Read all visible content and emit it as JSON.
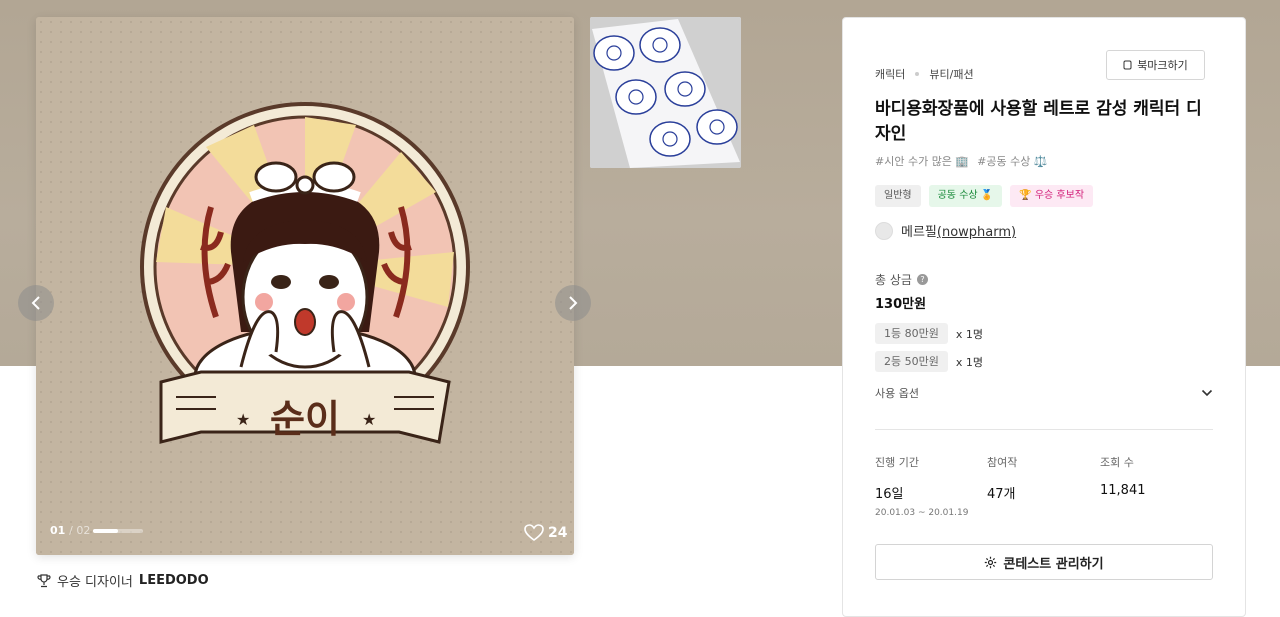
{
  "gallery": {
    "current": "01",
    "total": "/ 02",
    "progress": 0.5,
    "likes": "24",
    "artwork_text": "순이"
  },
  "winner": {
    "prefix": "우승 디자이너",
    "name": "LEEDODO"
  },
  "contest": {
    "categories": [
      "캐릭터",
      "뷰티/패션"
    ],
    "bookmark_label": "북마크하기",
    "title": "바디용화장품에 사용할 레트로 감성 캐릭터 디자인",
    "tags": [
      "#시안 수가 많은 🏢",
      "#공동 수상 ⚖️"
    ],
    "badges": [
      "일반형",
      "공동 수상 🏅",
      "🏆 우승 후보작"
    ],
    "author_name": "메르필",
    "author_handle": "(nowpharm)"
  },
  "prize": {
    "label": "총 상금",
    "total": "130만원",
    "rows": [
      {
        "rank": "1등 80만원",
        "count": "x 1명"
      },
      {
        "rank": "2등 50만원",
        "count": "x 1명"
      }
    ],
    "options_label": "사용 옵션"
  },
  "stats": {
    "period_label": "진행 기간",
    "period_value": "16일",
    "period_range": "20.01.03 ~ 20.01.19",
    "entries_label": "참여작",
    "entries_value": "47개",
    "views_label": "조회 수",
    "views_value": "11,841"
  },
  "actions": {
    "manage_label": "콘테스트 관리하기"
  },
  "colors": {
    "hero_bg": "#b2a694",
    "card_bg": "#c2b4a0",
    "green_badge": "#1a8a3a",
    "pink_badge": "#d2207a"
  }
}
